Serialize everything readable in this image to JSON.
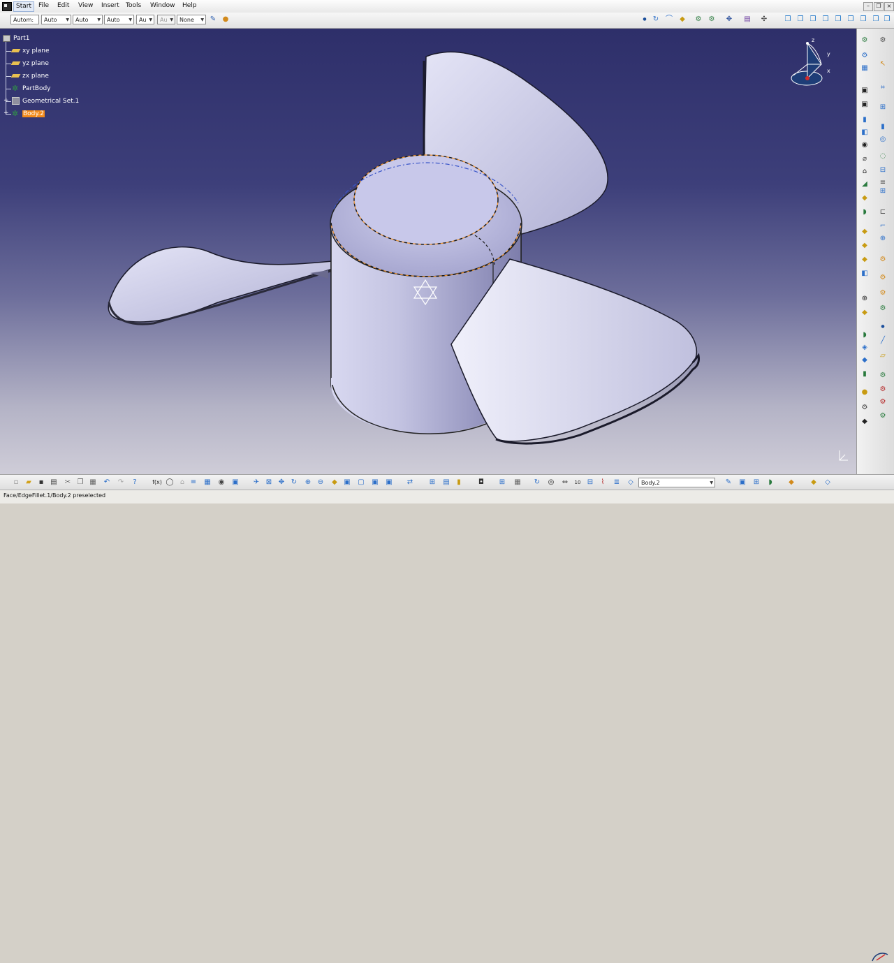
{
  "menu": {
    "items": [
      "Start",
      "File",
      "Edit",
      "View",
      "Insert",
      "Tools",
      "Window",
      "Help"
    ]
  },
  "toolbar": {
    "combos": [
      "Autom:",
      "Auto",
      "Auto",
      "Auto",
      "Au",
      "Au",
      "None"
    ]
  },
  "tree": {
    "nodes": [
      "Part1",
      "xy plane",
      "yz plane",
      "zx plane",
      "PartBody",
      "Geometrical Set.1",
      "Body.2"
    ],
    "selected_index": 6
  },
  "compass": {
    "axes": [
      "z",
      "y",
      "x"
    ]
  },
  "bottom_bar": {
    "current_body": "Body.2"
  },
  "status": {
    "text": "Face/EdgeFillet.1/Body.2 preselected"
  },
  "colors": {
    "background_top": "#2e2f6a",
    "background_bottom": "#cfcdd8",
    "selection_highlight": "#f38a1a",
    "part_surface": "#c7c7e6"
  }
}
